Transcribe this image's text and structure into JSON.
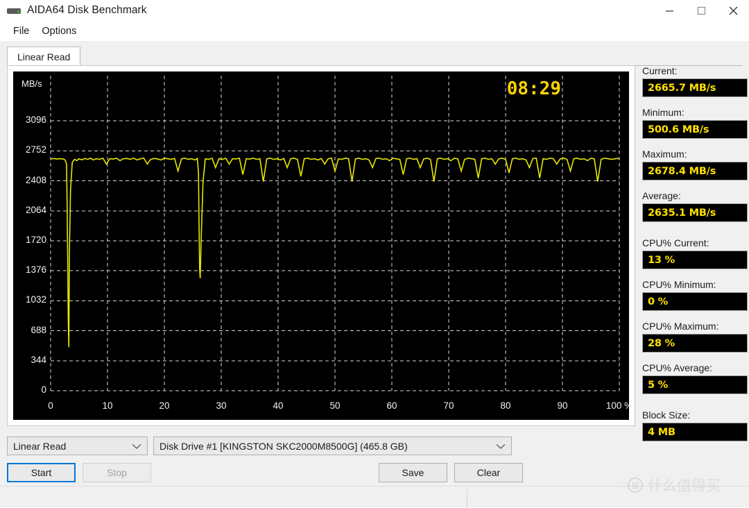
{
  "window": {
    "title": "AIDA64 Disk Benchmark",
    "icon": "disk-drive-icon",
    "minimize": "—",
    "maximize": "□",
    "close": "✕"
  },
  "menu": {
    "items": [
      {
        "label": "File"
      },
      {
        "label": "Options"
      }
    ]
  },
  "tabs": [
    {
      "label": "Linear Read",
      "active": true
    }
  ],
  "chart_data": {
    "type": "line",
    "title": "",
    "xlabel": "",
    "ylabel": "MB/s",
    "unit_label": "MB/s",
    "timer": "08:29",
    "xlim": [
      0,
      100
    ],
    "ylim": [
      0,
      3440
    ],
    "grid": true,
    "grid_color": "#d8d8d8",
    "background": "#000000",
    "line_color": "#e8e800",
    "x_ticks": [
      "0",
      "10",
      "20",
      "30",
      "40",
      "50",
      "60",
      "70",
      "80",
      "90",
      "100 %"
    ],
    "y_ticks": [
      "3096",
      "2752",
      "2408",
      "2064",
      "1720",
      "1376",
      "1032",
      "688",
      "344",
      "0"
    ],
    "y_tick_values": [
      3096,
      2752,
      2408,
      2064,
      1720,
      1376,
      1032,
      688,
      344,
      0
    ],
    "series": [
      {
        "name": "Linear Read",
        "x": [
          0,
          0.4,
          0.8,
          1.2,
          1.6,
          2.0,
          2.4,
          2.6,
          2.8,
          2.9,
          3.0,
          3.1,
          3.2,
          3.3,
          3.5,
          3.8,
          4.2,
          4.6,
          5.0,
          5.5,
          6.0,
          6.5,
          7.0,
          7.5,
          8.0,
          8.6,
          9.2,
          9.8,
          10.4,
          11.0,
          11.6,
          12.2,
          12.8,
          13.4,
          14.0,
          14.6,
          15.2,
          15.8,
          16.4,
          17.0,
          17.6,
          18.2,
          18.8,
          19.4,
          20.0,
          20.6,
          21.2,
          21.8,
          22.4,
          23.0,
          23.6,
          24.2,
          24.8,
          25.4,
          25.8,
          26.0,
          26.1,
          26.2,
          26.3,
          26.5,
          26.8,
          27.2,
          27.8,
          28.4,
          29.0,
          29.6,
          30.2,
          30.8,
          31.4,
          32.0,
          32.6,
          33.2,
          33.8,
          34.4,
          35.0,
          35.6,
          36.2,
          36.8,
          37.4,
          38.0,
          38.6,
          39.2,
          39.8,
          40.4,
          41.0,
          41.6,
          42.2,
          42.8,
          43.4,
          44.0,
          44.6,
          45.2,
          45.8,
          46.4,
          47.0,
          47.6,
          48.2,
          48.8,
          49.4,
          50.0,
          50.6,
          51.2,
          51.8,
          52.4,
          53.0,
          53.6,
          54.2,
          54.8,
          55.4,
          56.0,
          56.6,
          57.2,
          57.8,
          58.4,
          59.0,
          59.6,
          60.2,
          60.8,
          61.4,
          62.0,
          62.6,
          63.2,
          63.8,
          64.4,
          65.0,
          65.6,
          66.2,
          66.8,
          67.4,
          68.0,
          68.6,
          69.2,
          69.8,
          70.4,
          71.0,
          71.6,
          72.2,
          72.8,
          73.4,
          74.0,
          74.6,
          75.2,
          75.8,
          76.4,
          77.0,
          77.6,
          78.2,
          78.8,
          79.4,
          80.0,
          80.6,
          81.2,
          81.8,
          82.4,
          83.0,
          83.6,
          84.2,
          84.8,
          85.4,
          86.0,
          86.6,
          87.2,
          87.8,
          88.4,
          89.0,
          89.6,
          90.2,
          90.8,
          91.4,
          92.0,
          92.6,
          93.2,
          93.8,
          94.4,
          95.0,
          95.6,
          96.2,
          96.8,
          97.4,
          98.0,
          98.6,
          99.2,
          99.6,
          100
        ],
        "y": [
          2660,
          2664,
          2662,
          2658,
          2663,
          2660,
          2655,
          2640,
          2600,
          2150,
          1500,
          820,
          500,
          1600,
          2300,
          2620,
          2655,
          2640,
          2661,
          2650,
          2665,
          2655,
          2668,
          2648,
          2662,
          2655,
          2668,
          2600,
          2662,
          2658,
          2668,
          2640,
          2662,
          2665,
          2655,
          2668,
          2648,
          2662,
          2668,
          2600,
          2655,
          2665,
          2660,
          2648,
          2668,
          2662,
          2655,
          2665,
          2520,
          2660,
          2668,
          2655,
          2662,
          2648,
          2665,
          2500,
          1900,
          1400,
          1290,
          1800,
          2400,
          2660,
          2655,
          2668,
          2560,
          2662,
          2655,
          2668,
          2600,
          2662,
          2660,
          2668,
          2480,
          2662,
          2658,
          2668,
          2655,
          2662,
          2400,
          2660,
          2668,
          2655,
          2662,
          2648,
          2665,
          2560,
          2662,
          2668,
          2655,
          2460,
          2662,
          2668,
          2655,
          2662,
          2648,
          2665,
          2600,
          2662,
          2668,
          2520,
          2660,
          2655,
          2668,
          2662,
          2400,
          2660,
          2668,
          2655,
          2662,
          2648,
          2560,
          2665,
          2668,
          2655,
          2662,
          2640,
          2668,
          2660,
          2655,
          2480,
          2662,
          2668,
          2655,
          2662,
          2560,
          2660,
          2668,
          2655,
          2400,
          2662,
          2668,
          2655,
          2662,
          2640,
          2668,
          2660,
          2520,
          2655,
          2668,
          2662,
          2655,
          2440,
          2662,
          2668,
          2655,
          2662,
          2600,
          2660,
          2668,
          2655,
          2500,
          2662,
          2668,
          2655,
          2662,
          2648,
          2560,
          2665,
          2668,
          2440,
          2662,
          2655,
          2668,
          2662,
          2600,
          2660,
          2668,
          2655,
          2520,
          2662,
          2668,
          2655,
          2662,
          2640,
          2668,
          2660,
          2400,
          2655,
          2668,
          2662,
          2655,
          2660,
          2665,
          2662,
          2660
        ]
      }
    ]
  },
  "stats": [
    {
      "label": "Current:",
      "value": "2665.7 MB/s",
      "name": "current"
    },
    {
      "label": "Minimum:",
      "value": "500.6 MB/s",
      "name": "minimum"
    },
    {
      "label": "Maximum:",
      "value": "2678.4 MB/s",
      "name": "maximum"
    },
    {
      "label": "Average:",
      "value": "2635.1 MB/s",
      "name": "average"
    },
    {
      "label": "CPU% Current:",
      "value": "13 %",
      "name": "cpu-current"
    },
    {
      "label": "CPU% Minimum:",
      "value": "0 %",
      "name": "cpu-minimum"
    },
    {
      "label": "CPU% Maximum:",
      "value": "28 %",
      "name": "cpu-maximum"
    },
    {
      "label": "CPU% Average:",
      "value": "5 %",
      "name": "cpu-average"
    },
    {
      "label": "Block Size:",
      "value": "4 MB",
      "name": "block-size"
    }
  ],
  "controls": {
    "mode_value": "Linear Read",
    "drive_value": "Disk Drive #1  [KINGSTON SKC2000M8500G]  (465.8 GB)",
    "start_label": "Start",
    "stop_label": "Stop",
    "save_label": "Save",
    "clear_label": "Clear"
  },
  "watermark": {
    "badge": "值",
    "text": "什么值得买"
  },
  "colors": {
    "accent": "#0078d7",
    "chart_line": "#e8e800",
    "stat_text": "#ffe000",
    "chart_bg": "#000000"
  }
}
